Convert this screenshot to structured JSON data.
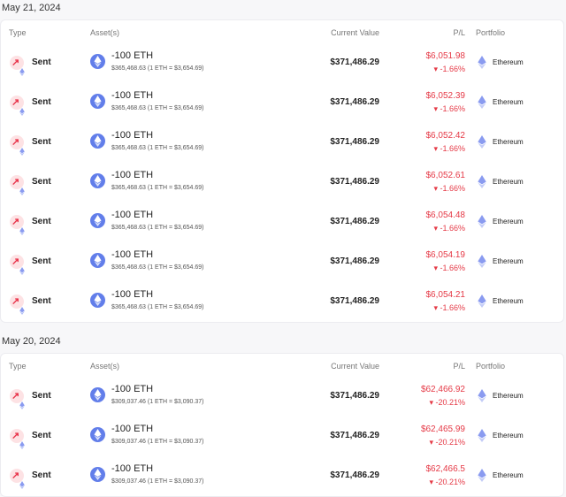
{
  "groups": [
    {
      "date": "May 21, 2024",
      "headers": {
        "type": "Type",
        "asset": "Asset(s)",
        "current_value": "Current Value",
        "pl": "P/L",
        "portfolio": "Portfolio"
      },
      "rows": [
        {
          "type": "Sent",
          "amount": "-100 ETH",
          "sub": "$365,468.63 (1 ETH = $3,654.69)",
          "current_value": "$371,486.29",
          "pl": "$6,051.98",
          "pl_pct": "▾ -1.66%",
          "portfolio": "Ethereum"
        },
        {
          "type": "Sent",
          "amount": "-100 ETH",
          "sub": "$365,468.63 (1 ETH = $3,654.69)",
          "current_value": "$371,486.29",
          "pl": "$6,052.39",
          "pl_pct": "▾ -1.66%",
          "portfolio": "Ethereum"
        },
        {
          "type": "Sent",
          "amount": "-100 ETH",
          "sub": "$365,468.63 (1 ETH = $3,654.69)",
          "current_value": "$371,486.29",
          "pl": "$6,052.42",
          "pl_pct": "▾ -1.66%",
          "portfolio": "Ethereum"
        },
        {
          "type": "Sent",
          "amount": "-100 ETH",
          "sub": "$365,468.63 (1 ETH = $3,654.69)",
          "current_value": "$371,486.29",
          "pl": "$6,052.61",
          "pl_pct": "▾ -1.66%",
          "portfolio": "Ethereum"
        },
        {
          "type": "Sent",
          "amount": "-100 ETH",
          "sub": "$365,468.63 (1 ETH = $3,654.69)",
          "current_value": "$371,486.29",
          "pl": "$6,054.48",
          "pl_pct": "▾ -1.66%",
          "portfolio": "Ethereum"
        },
        {
          "type": "Sent",
          "amount": "-100 ETH",
          "sub": "$365,468.63 (1 ETH = $3,654.69)",
          "current_value": "$371,486.29",
          "pl": "$6,054.19",
          "pl_pct": "▾ -1.66%",
          "portfolio": "Ethereum"
        },
        {
          "type": "Sent",
          "amount": "-100 ETH",
          "sub": "$365,468.63 (1 ETH = $3,654.69)",
          "current_value": "$371,486.29",
          "pl": "$6,054.21",
          "pl_pct": "▾ -1.66%",
          "portfolio": "Ethereum"
        }
      ]
    },
    {
      "date": "May 20, 2024",
      "headers": {
        "type": "Type",
        "asset": "Asset(s)",
        "current_value": "Current Value",
        "pl": "P/L",
        "portfolio": "Portfolio"
      },
      "rows": [
        {
          "type": "Sent",
          "amount": "-100 ETH",
          "sub": "$309,037.46 (1 ETH = $3,090.37)",
          "current_value": "$371,486.29",
          "pl": "$62,466.92",
          "pl_pct": "▾ -20.21%",
          "portfolio": "Ethereum"
        },
        {
          "type": "Sent",
          "amount": "-100 ETH",
          "sub": "$309,037.46 (1 ETH = $3,090.37)",
          "current_value": "$371,486.29",
          "pl": "$62,465.99",
          "pl_pct": "▾ -20.21%",
          "portfolio": "Ethereum"
        },
        {
          "type": "Sent",
          "amount": "-100 ETH",
          "sub": "$309,037.46 (1 ETH = $3,090.37)",
          "current_value": "$371,486.29",
          "pl": "$62,466.5",
          "pl_pct": "▾ -20.21%",
          "portfolio": "Ethereum"
        }
      ]
    }
  ],
  "colors": {
    "loss": "#e53946",
    "eth": "#627eea",
    "sent_bg": "#fde2e4"
  },
  "icons": {
    "type": "arrow-up-right-icon",
    "chain": "ethereum-icon",
    "asset": "eth-coin-icon"
  }
}
